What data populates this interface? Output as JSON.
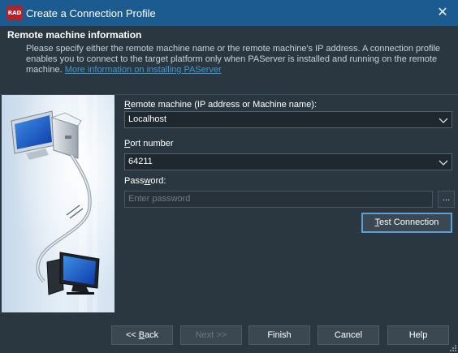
{
  "window": {
    "title": "Create a Connection Profile",
    "app_icon_text": "RAD",
    "close_glyph": "✕"
  },
  "header": {
    "title": "Remote machine information",
    "description": "Please specify either the remote machine name or the remote machine's IP address. A connection profile enables you to connect to the target platform only when PAServer is installed and running on the remote machine. ",
    "link": "More information on installing PAServer"
  },
  "form": {
    "remote_machine": {
      "label_mnemonic": "R",
      "label_rest": "emote machine (IP address or Machine name):",
      "value": "Localhost"
    },
    "port": {
      "label_mnemonic": "P",
      "label_rest": "ort number",
      "value": "64211"
    },
    "password": {
      "label_prefix": "Pass",
      "label_mnemonic": "w",
      "label_rest": "ord:",
      "placeholder": "Enter password",
      "browse_label": "..."
    },
    "test_connection": {
      "mnemonic": "T",
      "rest": "est Connection"
    }
  },
  "footer": {
    "back_prefix": "<< ",
    "back_mnemonic": "B",
    "back_rest": "ack",
    "next_label": "Next >>",
    "finish_label": "Finish",
    "cancel_label": "Cancel",
    "help_label": "Help"
  },
  "colors": {
    "titlebar": "#1c5b90",
    "background": "#2b3740",
    "link": "#3a9ad9",
    "focus_border": "#5a9fd8"
  },
  "icons": [
    "close-icon",
    "dropdown-chevron-icon",
    "computer-illustration",
    "resize-grip-icon"
  ]
}
